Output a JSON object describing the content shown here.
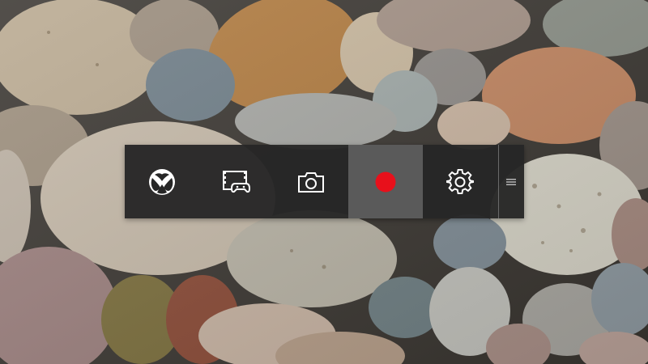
{
  "background": {
    "scene": "river-stones-wallpaper"
  },
  "game_bar": {
    "background_color": "#262626",
    "selected_color": "#5a5a5a",
    "record_color": "#e8101b",
    "icon_color": "#ffffff",
    "buttons": [
      {
        "id": "xbox",
        "icon": "xbox-logo-icon",
        "selected": false
      },
      {
        "id": "game-dvr",
        "icon": "game-dvr-icon",
        "selected": false
      },
      {
        "id": "screenshot",
        "icon": "camera-icon",
        "selected": false
      },
      {
        "id": "record",
        "icon": "record-icon",
        "selected": true
      },
      {
        "id": "settings",
        "icon": "gear-icon",
        "selected": false
      }
    ],
    "grip_icon": "drag-grip-icon"
  }
}
